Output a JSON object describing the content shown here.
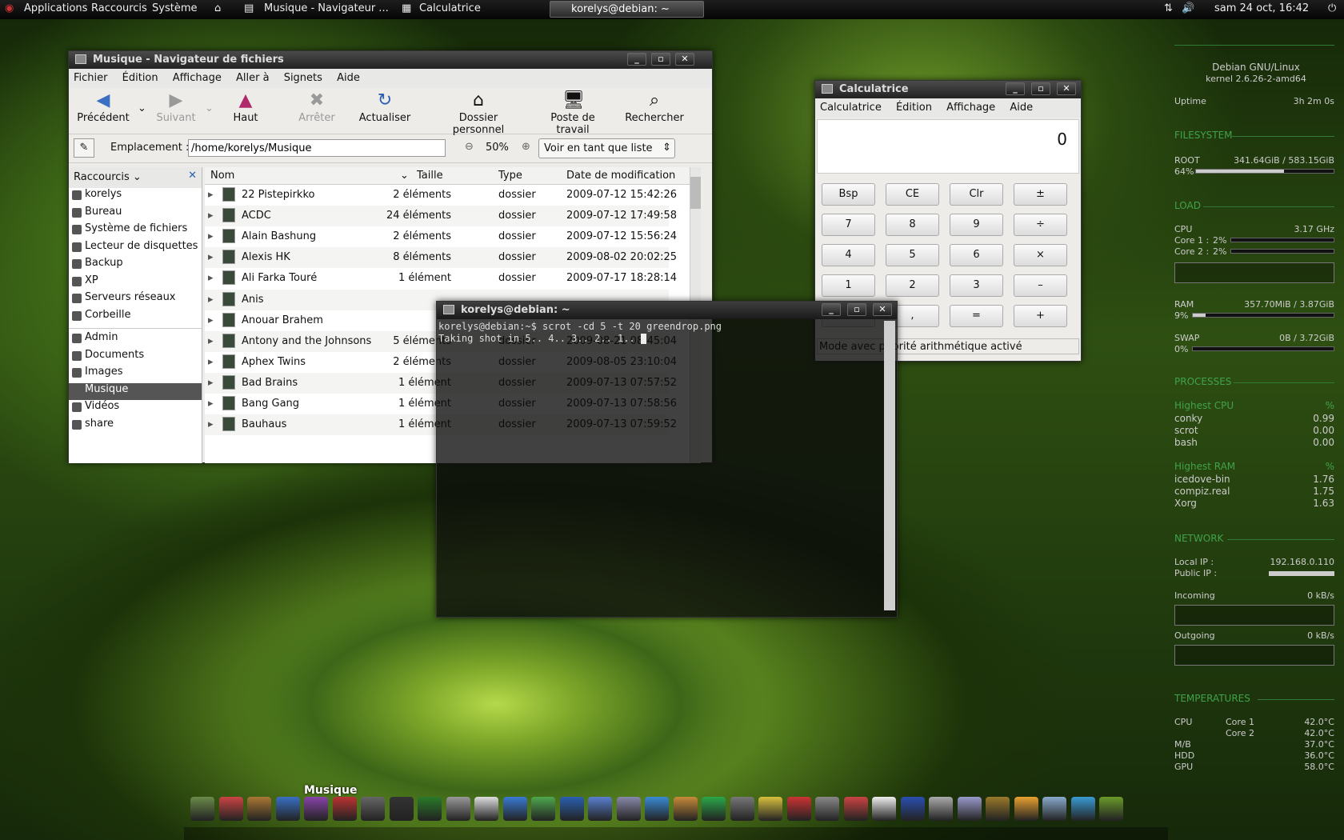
{
  "topbar": {
    "applications": "Applications",
    "shortcuts": "Raccourcis",
    "system": "Système",
    "task_files": "Musique - Navigateur ...",
    "task_calc": "Calculatrice",
    "task_term": "korelys@debian: ~",
    "clock": "sam 24 oct, 16:42"
  },
  "files": {
    "title": "Musique - Navigateur de fichiers",
    "menu": [
      "Fichier",
      "Édition",
      "Affichage",
      "Aller à",
      "Signets",
      "Aide"
    ],
    "toolbar": {
      "back": "Précédent",
      "forward": "Suivant",
      "up": "Haut",
      "stop": "Arrêter",
      "reload": "Actualiser",
      "home": "Dossier personnel",
      "computer": "Poste de travail",
      "search": "Rechercher"
    },
    "location_label": "Emplacement :",
    "location": "/home/korelys/Musique",
    "zoom": "50%",
    "view_mode": "Voir en tant que liste",
    "side_header": "Raccourcis",
    "places": [
      "korelys",
      "Bureau",
      "Système de fichiers",
      "Lecteur de disquettes",
      "Backup",
      "XP",
      "Serveurs réseaux",
      "Corbeille"
    ],
    "bookmarks": [
      "Admin",
      "Documents",
      "Images",
      "Musique",
      "Vidéos",
      "share"
    ],
    "columns": {
      "name": "Nom",
      "size": "Taille",
      "type": "Type",
      "date": "Date de modification"
    },
    "rows": [
      {
        "name": "22 Pistepirkko",
        "size": "2 éléments",
        "type": "dossier",
        "date": "2009-07-12 15:42:26"
      },
      {
        "name": "ACDC",
        "size": "24 éléments",
        "type": "dossier",
        "date": "2009-07-12 17:49:58"
      },
      {
        "name": "Alain Bashung",
        "size": "2 éléments",
        "type": "dossier",
        "date": "2009-07-12 15:56:24"
      },
      {
        "name": "Alexis HK",
        "size": "8 éléments",
        "type": "dossier",
        "date": "2009-08-02 20:02:25"
      },
      {
        "name": "Ali Farka Touré",
        "size": "1 élément",
        "type": "dossier",
        "date": "2009-07-17 18:28:14"
      },
      {
        "name": "Anis",
        "size": "",
        "type": "",
        "date": ""
      },
      {
        "name": "Anouar Brahem",
        "size": "",
        "type": "",
        "date": ""
      },
      {
        "name": "Antony and the Johnsons",
        "size": "5 éléments",
        "type": "dossier",
        "date": "2009-08-21 08:45:04"
      },
      {
        "name": "Aphex Twins",
        "size": "2 éléments",
        "type": "dossier",
        "date": "2009-08-05 23:10:04"
      },
      {
        "name": "Bad Brains",
        "size": "1 élément",
        "type": "dossier",
        "date": "2009-07-13 07:57:52"
      },
      {
        "name": "Bang Gang",
        "size": "1 élément",
        "type": "dossier",
        "date": "2009-07-13 07:58:56"
      },
      {
        "name": "Bauhaus",
        "size": "1 élément",
        "type": "dossier",
        "date": "2009-07-13 07:59:52"
      }
    ]
  },
  "calc": {
    "title": "Calculatrice",
    "menu": [
      "Calculatrice",
      "Édition",
      "Affichage",
      "Aide"
    ],
    "display": "0",
    "keys": [
      "Bsp",
      "CE",
      "Clr",
      "±",
      "7",
      "8",
      "9",
      "÷",
      "4",
      "5",
      "6",
      "×",
      "1",
      "2",
      "3",
      "–",
      "",
      ",",
      "=",
      "+"
    ],
    "status": "Mode avec priorité arithmétique activé"
  },
  "terminal": {
    "title": "korelys@debian: ~",
    "line1": "korelys@debian:~$ scrot -cd 5 -t 20 greendrop.png",
    "line2": "Taking shot in 5.. 4.. 3.. 2.. 1.. "
  },
  "conky": {
    "os": "Debian GNU/Linux",
    "kernel": "kernel 2.6.26-2-amd64",
    "uptime_label": "Uptime",
    "uptime": "3h 2m 0s",
    "filesystem": "FILESYSTEM",
    "root_label": "ROOT",
    "root_value": "341.64GiB / 583.15GiB",
    "root_pct": "64%",
    "root_fill": 0.64,
    "load": "LOAD",
    "cpu_label": "CPU",
    "cpu_freq": "3.17 GHz",
    "core1": "Core 1 :",
    "core1_pct": "2%",
    "core2": "Core 2 :",
    "core2_pct": "2%",
    "ram_label": "RAM",
    "ram_value": "357.70MiB / 3.87GiB",
    "ram_pct": "9%",
    "ram_fill": 0.09,
    "swap_label": "SWAP",
    "swap_value": "0B / 3.72GiB",
    "swap_pct": "0%",
    "swap_fill": 0,
    "processes": "PROCESSES",
    "hcpu": "Highest CPU",
    "pct": "%",
    "cpu_procs": [
      {
        "n": "conky",
        "v": "0.99"
      },
      {
        "n": "scrot",
        "v": "0.00"
      },
      {
        "n": "bash",
        "v": "0.00"
      }
    ],
    "hram": "Highest RAM",
    "ram_procs": [
      {
        "n": "icedove-bin",
        "v": "1.76"
      },
      {
        "n": "compiz.real",
        "v": "1.75"
      },
      {
        "n": "Xorg",
        "v": "1.63"
      }
    ],
    "network": "NETWORK",
    "local_ip_label": "Local IP :",
    "local_ip": "192.168.0.110",
    "public_ip_label": "Public IP :",
    "incoming": "Incoming",
    "incoming_v": "0 kB/s",
    "outgoing": "Outgoing",
    "outgoing_v": "0 kB/s",
    "temps": "TEMPERATURES",
    "t_cpu": "CPU",
    "t_core1": "Core 1",
    "t_core1_v": "42.0°C",
    "t_core2": "Core 2",
    "t_core2_v": "42.0°C",
    "t_mb": "M/B",
    "t_mb_v": "37.0°C",
    "t_hdd": "HDD",
    "t_hdd_v": "36.0°C",
    "t_gpu": "GPU",
    "t_gpu_v": "58.0°C"
  },
  "dock": {
    "label": "Musique"
  }
}
